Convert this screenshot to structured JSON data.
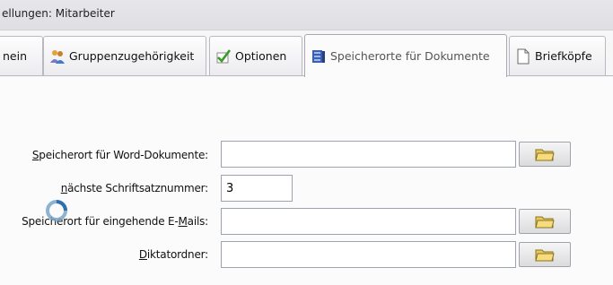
{
  "window": {
    "title": "ellungen: Mitarbeiter"
  },
  "tabs": [
    {
      "label": "nein",
      "icon": null,
      "active": false
    },
    {
      "label": "Gruppenzugehörigkeit",
      "icon": "group-icon",
      "active": false
    },
    {
      "label": "Optionen",
      "icon": "checkmark-icon",
      "active": false
    },
    {
      "label": "Speicherorte für Dokumente",
      "icon": "document-storage-icon",
      "active": true
    },
    {
      "label": "Briefköpfe",
      "icon": "document-icon",
      "active": false
    }
  ],
  "form": {
    "word_location": {
      "label_accel": "S",
      "label_rest": "peicherort für Word-Dokumente:",
      "value": ""
    },
    "next_number": {
      "label_accel": "n",
      "label_rest": "ächste Schriftsatznummer:",
      "value": "3"
    },
    "email_location": {
      "label_pre": "Speicherort für eingehende E-",
      "label_accel": "M",
      "label_post": "ails:",
      "value": ""
    },
    "dictation_folder": {
      "label_accel": "D",
      "label_rest": "iktatordner:",
      "value": ""
    }
  },
  "icons": {
    "browse": "folder-icon",
    "busy_cursor": "busy-cursor-icon"
  },
  "colors": {
    "active_tab_text": "#555555",
    "field_border": "#9da3ae"
  }
}
